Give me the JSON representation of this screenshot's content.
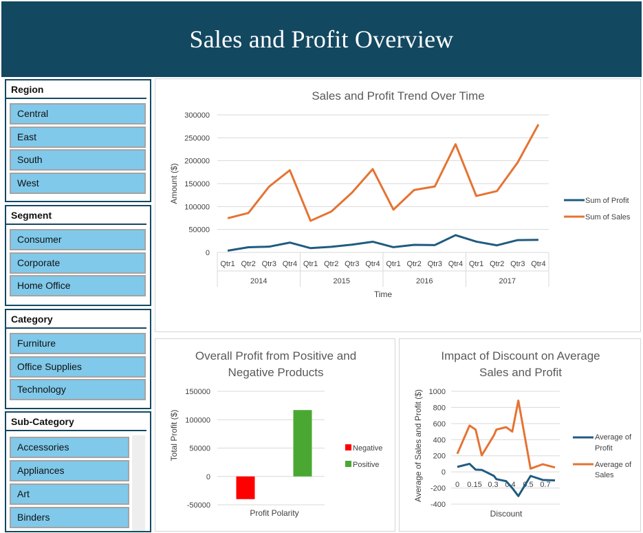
{
  "header": {
    "title": "Sales and Profit Overview"
  },
  "slicers": {
    "region": {
      "title": "Region",
      "items": [
        "Central",
        "East",
        "South",
        "West"
      ]
    },
    "segment": {
      "title": "Segment",
      "items": [
        "Consumer",
        "Corporate",
        "Home Office"
      ]
    },
    "category": {
      "title": "Category",
      "items": [
        "Furniture",
        "Office Supplies",
        "Technology"
      ]
    },
    "subcategory": {
      "title": "Sub-Category",
      "items": [
        "Accessories",
        "Appliances",
        "Art",
        "Binders"
      ]
    }
  },
  "colors": {
    "header_bg": "#134861",
    "slicer_button": "#80c9ea",
    "profit_line": "#1f5b80",
    "sales_line": "#e57332",
    "negative_bar": "#ff0000",
    "positive_bar": "#4aa832"
  },
  "chart_data": [
    {
      "type": "line",
      "title": "Sales and Profit Trend Over Time",
      "xlabel": "Time",
      "ylabel": "Amount ($)",
      "ylim": [
        0,
        300000
      ],
      "yticks": [
        "300000",
        "250000",
        "200000",
        "150000",
        "100000",
        "50000",
        "0"
      ],
      "groups": [
        "2014",
        "2015",
        "2016",
        "2017"
      ],
      "categories": [
        "Qtr1",
        "Qtr2",
        "Qtr3",
        "Qtr4",
        "Qtr1",
        "Qtr2",
        "Qtr3",
        "Qtr4",
        "Qtr1",
        "Qtr2",
        "Qtr3",
        "Qtr4",
        "Qtr1",
        "Qtr2",
        "Qtr3",
        "Qtr4"
      ],
      "series": [
        {
          "name": "Sum of Profit",
          "values": [
            3800,
            11200,
            12500,
            21400,
            9300,
            12200,
            16900,
            23300,
            11400,
            16500,
            16000,
            37600,
            23500,
            15400,
            26900,
            27400
          ]
        },
        {
          "name": "Sum of Sales",
          "values": [
            74500,
            86000,
            143600,
            179200,
            68900,
            89100,
            130300,
            181700,
            93200,
            136100,
            143800,
            236000,
            123100,
            133800,
            196300,
            279200
          ]
        }
      ],
      "legend": "right",
      "grid": true
    },
    {
      "type": "bar",
      "title": "Overall Profit from Positive and Negative Products",
      "xlabel": "Profit Polarity",
      "ylabel": "Total Profit ($)",
      "ylim": [
        -50000,
        150000
      ],
      "yticks": [
        "150000",
        "100000",
        "50000",
        "0",
        "-50000"
      ],
      "series": [
        {
          "name": "Negative",
          "values": [
            -40000
          ]
        },
        {
          "name": "Positive",
          "values": [
            117000
          ]
        }
      ],
      "legend": "right",
      "grid": true
    },
    {
      "type": "line",
      "title": "Impact of Discount on Average Sales and Profit",
      "xlabel": "Discount",
      "ylabel": "Average of Sales and Profit ($)",
      "ylim": [
        -400,
        1000
      ],
      "yticks": [
        "1000",
        "800",
        "600",
        "400",
        "200",
        "0",
        "-200",
        "-400"
      ],
      "xticks": [
        "0",
        "0.15",
        "0.3",
        "0.4",
        "0.5",
        "0.7"
      ],
      "x": [
        0,
        0.1,
        0.15,
        0.2,
        0.3,
        0.32,
        0.4,
        0.45,
        0.5,
        0.6,
        0.7,
        0.8
      ],
      "series": [
        {
          "name": "Average of Profit",
          "values": [
            62,
            100,
            28,
            25,
            -50,
            -90,
            -115,
            -200,
            -300,
            -50,
            -100,
            -105
          ]
        },
        {
          "name": "Average of Sales",
          "values": [
            225,
            575,
            525,
            205,
            455,
            525,
            555,
            500,
            885,
            40,
            95,
            55
          ]
        }
      ],
      "legend": "right",
      "grid": true
    }
  ]
}
